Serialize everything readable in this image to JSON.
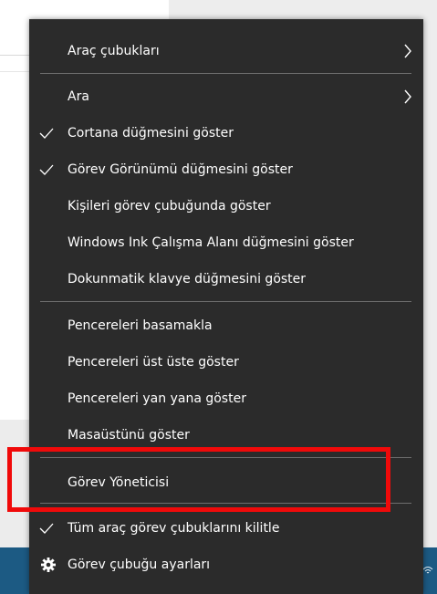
{
  "menu": {
    "items": [
      {
        "label": "Araç çubukları",
        "submenu": true
      },
      {
        "label": "Ara",
        "submenu": true
      },
      {
        "label": "Cortana düğmesini göster",
        "checked": true
      },
      {
        "label": "Görev Görünümü düğmesini göster",
        "checked": true
      },
      {
        "label": "Kişileri görev çubuğunda göster"
      },
      {
        "label": "Windows Ink Çalışma Alanı düğmesini göster"
      },
      {
        "label": "Dokunmatik klavye düğmesini göster"
      },
      {
        "label": "Pencereleri basamakla"
      },
      {
        "label": "Pencereleri üst üste göster"
      },
      {
        "label": "Pencereleri yan yana göster"
      },
      {
        "label": "Masaüstünü göster"
      },
      {
        "label": "Görev Yöneticisi",
        "highlighted": true
      },
      {
        "label": "Tüm araç görev çubuklarını kilitle",
        "checked": true
      },
      {
        "label": "Görev çubuğu ayarları",
        "icon": "gear-icon"
      }
    ]
  },
  "colors": {
    "menu_bg": "#2b2b2b",
    "menu_text": "#ffffff",
    "separator": "#6e6e6e",
    "highlight_border": "#f00a0a",
    "taskbar": "#1c5a83"
  }
}
